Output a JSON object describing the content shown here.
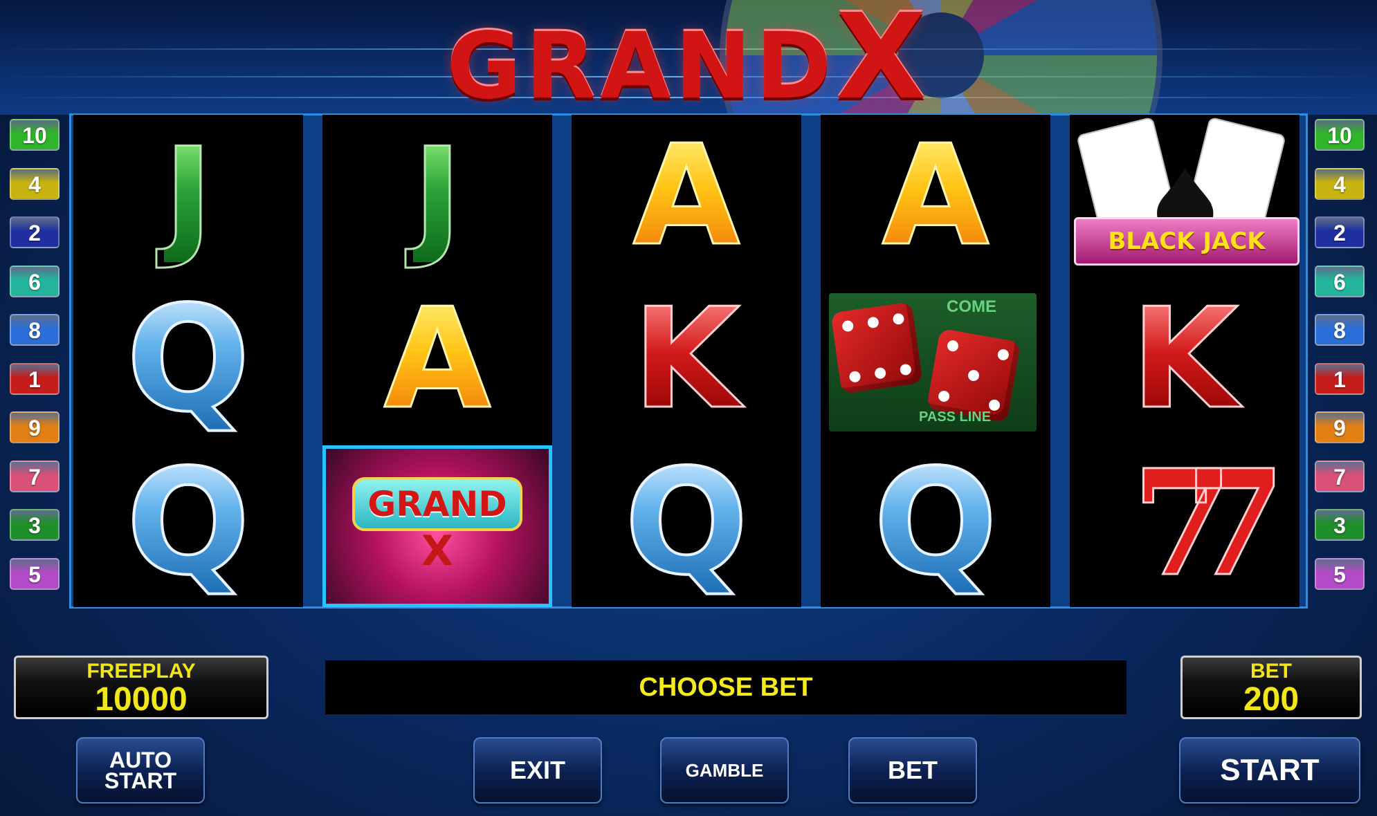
{
  "game": {
    "title_main": "GRAND",
    "title_x": "X"
  },
  "payline_badges": {
    "left": [
      {
        "num": "10",
        "color": "#2fb52a"
      },
      {
        "num": "4",
        "color": "#c7b410"
      },
      {
        "num": "2",
        "color": "#1f2f9e"
      },
      {
        "num": "6",
        "color": "#22b59c"
      },
      {
        "num": "8",
        "color": "#2a6fd9"
      },
      {
        "num": "1",
        "color": "#c51c1c"
      },
      {
        "num": "9",
        "color": "#e07f14"
      },
      {
        "num": "7",
        "color": "#d9507a"
      },
      {
        "num": "3",
        "color": "#1f8f2a"
      },
      {
        "num": "5",
        "color": "#b24bc7"
      }
    ],
    "right": [
      {
        "num": "10",
        "color": "#2fb52a"
      },
      {
        "num": "4",
        "color": "#c7b410"
      },
      {
        "num": "2",
        "color": "#1f2f9e"
      },
      {
        "num": "6",
        "color": "#22b59c"
      },
      {
        "num": "8",
        "color": "#2a6fd9"
      },
      {
        "num": "1",
        "color": "#c51c1c"
      },
      {
        "num": "9",
        "color": "#e07f14"
      },
      {
        "num": "7",
        "color": "#d9507a"
      },
      {
        "num": "3",
        "color": "#1f8f2a"
      },
      {
        "num": "5",
        "color": "#b24bc7"
      }
    ]
  },
  "reels": [
    [
      "J",
      "Q",
      "Q"
    ],
    [
      "J",
      "A",
      "grand-x"
    ],
    [
      "A",
      "K",
      "Q"
    ],
    [
      "A",
      "dice",
      "Q"
    ],
    [
      "blackjack",
      "K",
      "seven"
    ]
  ],
  "symbols": {
    "J": "J",
    "Q": "Q",
    "A": "A",
    "K": "K",
    "grand_sign": "GRAND",
    "grand_x": "X",
    "blackjack_label": "BLACK JACK",
    "dice_come": "COME",
    "dice_pass": "PASS LINE",
    "seven": "77"
  },
  "freeplay": {
    "label": "FREEPLAY",
    "value": "10000"
  },
  "message": "CHOOSE BET",
  "bet": {
    "label": "BET",
    "value": "200"
  },
  "buttons": {
    "auto_start_line1": "AUTO",
    "auto_start_line2": "START",
    "exit": "EXIT",
    "gamble": "GAMBLE",
    "bet": "BET",
    "start": "START"
  }
}
